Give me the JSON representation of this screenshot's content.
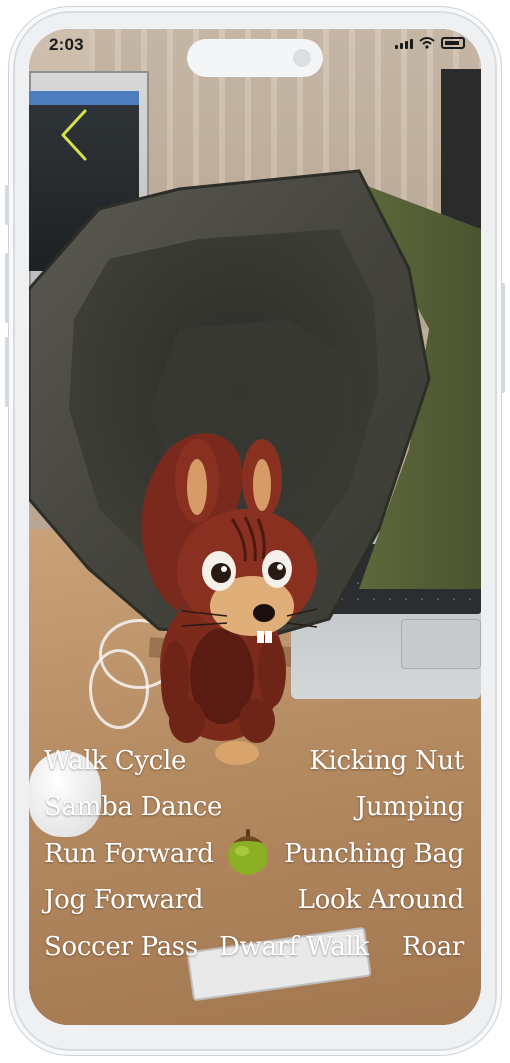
{
  "status_bar": {
    "time": "2:03"
  },
  "navigation": {
    "back_icon": "chevron-left-icon",
    "back_color": "#d6e04a"
  },
  "animation_menu": {
    "left": [
      "Walk Cycle",
      "Samba Dance",
      "Run Forward",
      "Jog Forward",
      "Soccer Pass"
    ],
    "right": [
      "Kicking Nut",
      "Jumping",
      "Punching Bag",
      "Look Around",
      "Roar"
    ],
    "center": "Dwarf Walk"
  },
  "selection_indicator": {
    "icon": "acorn-icon",
    "color": "#8bb026"
  }
}
